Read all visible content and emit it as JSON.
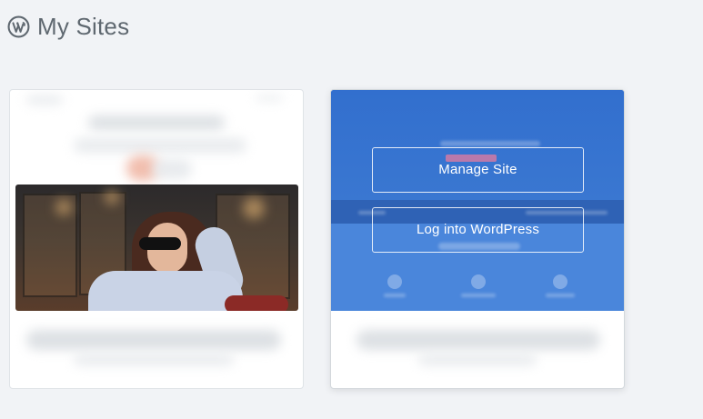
{
  "header": {
    "icon": "wordpress-logo-icon",
    "title": "My Sites"
  },
  "sites": [
    {
      "id": "left",
      "hover_actions": []
    },
    {
      "id": "right",
      "hover_actions": [
        {
          "label": "Manage Site"
        },
        {
          "label": "Log into WordPress"
        }
      ]
    }
  ],
  "colors": {
    "background": "#f1f3f6",
    "accent_blue": "#2e6fd5",
    "title_gray": "#5f6870"
  }
}
